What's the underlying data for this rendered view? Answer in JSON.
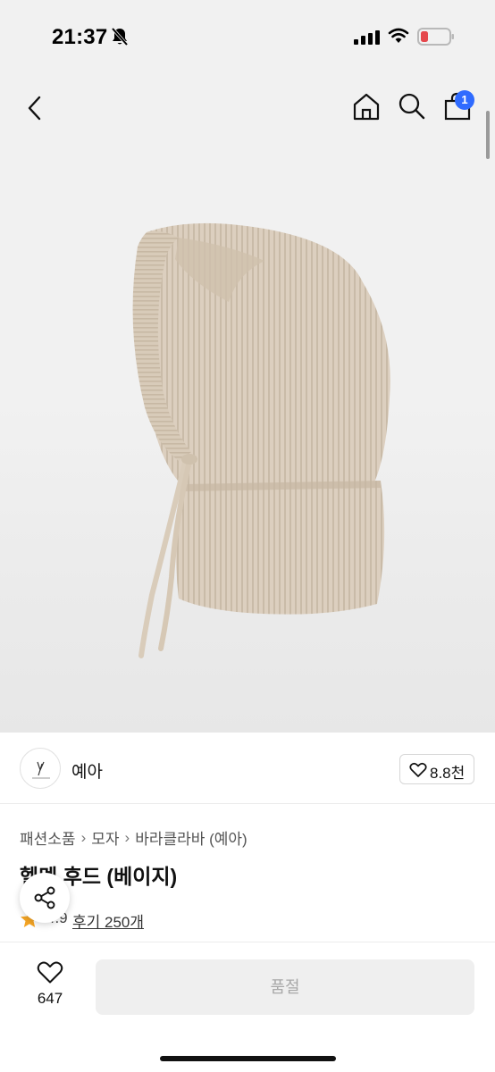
{
  "status_bar": {
    "time": "21:37",
    "icons": [
      "bell-slash-icon",
      "signal-icon",
      "wifi-icon",
      "battery-low-icon"
    ],
    "battery_color": "#e5484d"
  },
  "nav": {
    "icons": [
      "back-icon",
      "home-icon",
      "search-icon",
      "shopping-bag-icon"
    ],
    "cart_badge": "1",
    "badge_color": "#2f6bff"
  },
  "product": {
    "image": "knit-balaclava-beige"
  },
  "store": {
    "name": "예아",
    "like_count": "8.8천"
  },
  "breadcrumb": [
    "패션소품",
    "모자",
    "바라클라바 (예아)"
  ],
  "title": "헬멧 후드 (베이지)",
  "rating": {
    "value": "4.9",
    "reviews": "후기 250개"
  },
  "bottom_bar": {
    "wish_count": "647",
    "buy_label": "품절"
  }
}
